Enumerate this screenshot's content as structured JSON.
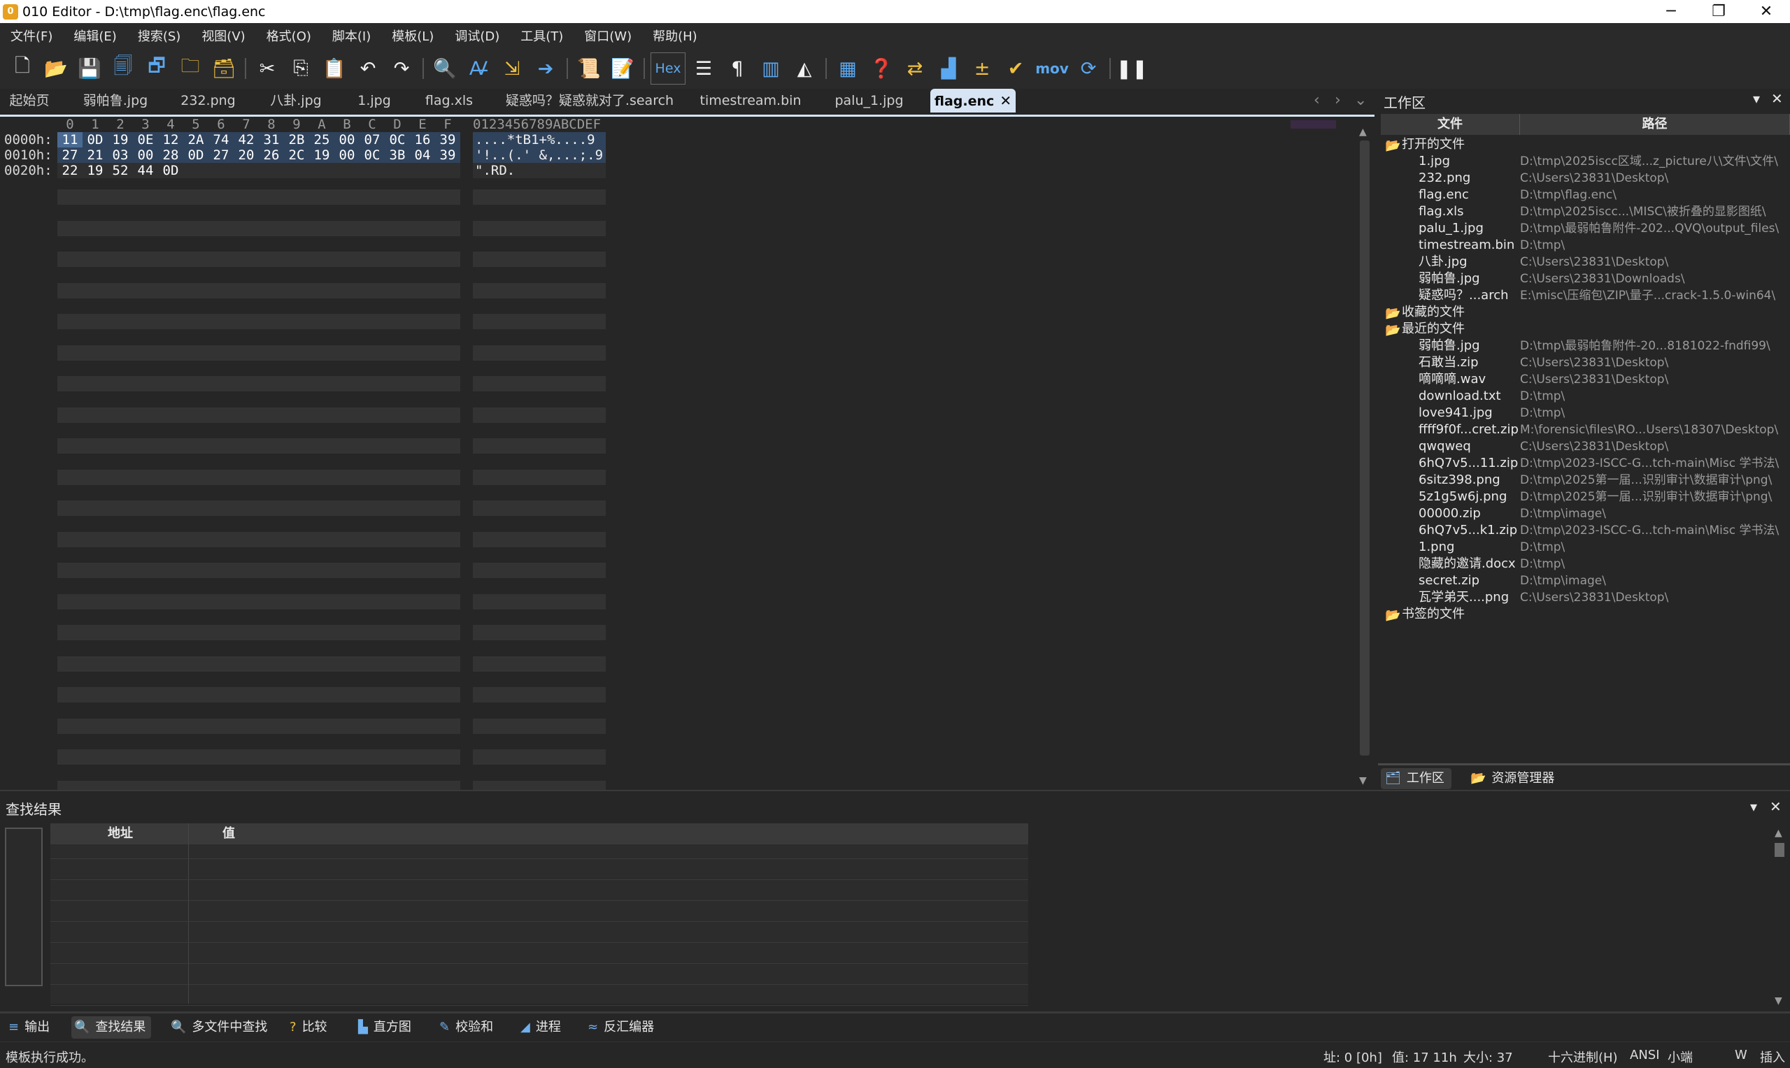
{
  "window": {
    "title": "010 Editor - D:\\tmp\\flag.enc\\flag.enc",
    "controls": [
      "─",
      "❐",
      "✕"
    ]
  },
  "menu": [
    "文件(F)",
    "编辑(E)",
    "搜索(S)",
    "视图(V)",
    "格式(O)",
    "脚本(I)",
    "模板(L)",
    "调试(D)",
    "工具(T)",
    "窗口(W)",
    "帮助(H)"
  ],
  "toolbar": {
    "hex_label": "Hex",
    "mov_label": "mov",
    "icons": [
      "new-file-icon",
      "open-file-icon",
      "save-icon",
      "save-as-icon",
      "save-all-icon",
      "open-folder-icon",
      "workspace-icon",
      "cut-icon",
      "copy-icon",
      "paste-icon",
      "undo-icon",
      "redo-icon",
      "find-icon",
      "replace-icon",
      "goto-icon",
      "jump-icon",
      "run-script-icon",
      "run-template-icon",
      "hex-mode-icon",
      "columns-icon",
      "paragraph-icon",
      "split-view-icon",
      "highlight-icon",
      "calculator-icon",
      "compare-icon",
      "swap-icon",
      "histogram-icon",
      "checksum-icon",
      "verify-icon",
      "mov-icon",
      "base-convert-icon",
      "pause-icon"
    ]
  },
  "tabs": [
    {
      "label": "起始页",
      "active": false
    },
    {
      "label": "弱帕鲁.jpg",
      "active": false
    },
    {
      "label": "232.png",
      "active": false
    },
    {
      "label": "八卦.jpg",
      "active": false
    },
    {
      "label": "1.jpg",
      "active": false
    },
    {
      "label": "flag.xls",
      "active": false
    },
    {
      "label": "疑惑吗？疑惑就对了.search",
      "active": false
    },
    {
      "label": "timestream.bin",
      "active": false
    },
    {
      "label": "palu_1.jpg",
      "active": false
    },
    {
      "label": "flag.enc",
      "active": true
    }
  ],
  "hex": {
    "column_header": [
      "0",
      "1",
      "2",
      "3",
      "4",
      "5",
      "6",
      "7",
      "8",
      "9",
      "A",
      "B",
      "C",
      "D",
      "E",
      "F"
    ],
    "ascii_header": "0123456789ABCDEF",
    "rows": [
      {
        "address": "0000h:",
        "bytes": [
          "11",
          "0D",
          "19",
          "0E",
          "12",
          "2A",
          "74",
          "42",
          "31",
          "2B",
          "25",
          "00",
          "07",
          "0C",
          "16",
          "39"
        ],
        "ascii": "....*tB1+%....9"
      },
      {
        "address": "0010h:",
        "bytes": [
          "27",
          "21",
          "03",
          "00",
          "28",
          "0D",
          "27",
          "20",
          "26",
          "2C",
          "19",
          "00",
          "0C",
          "3B",
          "04",
          "39"
        ],
        "ascii": "'!..(.' &,...;.9"
      },
      {
        "address": "0020h:",
        "bytes": [
          "22",
          "19",
          "52",
          "44",
          "0D"
        ],
        "ascii": "\".RD."
      }
    ]
  },
  "workspace": {
    "title": "工作区",
    "col_file": "文件",
    "col_path": "路径",
    "groups": [
      {
        "label": "打开的文件",
        "files": [
          {
            "name": "1.jpg",
            "path": "D:\\tmp\\2025iscc区域...z_picture八\\文件\\文件\\"
          },
          {
            "name": "232.png",
            "path": "C:\\Users\\23831\\Desktop\\"
          },
          {
            "name": "flag.enc",
            "path": "D:\\tmp\\flag.enc\\"
          },
          {
            "name": "flag.xls",
            "path": "D:\\tmp\\2025iscc...\\MISC\\被折叠的显影图纸\\"
          },
          {
            "name": "palu_1.jpg",
            "path": "D:\\tmp\\最弱帕鲁附件-202...QVQ\\output_files\\"
          },
          {
            "name": "timestream.bin",
            "path": "D:\\tmp\\"
          },
          {
            "name": "八卦.jpg",
            "path": "C:\\Users\\23831\\Desktop\\"
          },
          {
            "name": "弱帕鲁.jpg",
            "path": "C:\\Users\\23831\\Downloads\\"
          },
          {
            "name": "疑惑吗？...arch",
            "path": "E:\\misc\\压缩包\\ZIP\\量子...crack-1.5.0-win64\\"
          }
        ]
      },
      {
        "label": "收藏的文件",
        "files": []
      },
      {
        "label": "最近的文件",
        "files": [
          {
            "name": "弱帕鲁.jpg",
            "path": "D:\\tmp\\最弱帕鲁附件-20...8181022-fndfi99\\"
          },
          {
            "name": "石敢当.zip",
            "path": "C:\\Users\\23831\\Desktop\\"
          },
          {
            "name": "嘀嘀嘀.wav",
            "path": "C:\\Users\\23831\\Desktop\\"
          },
          {
            "name": "download.txt",
            "path": "D:\\tmp\\"
          },
          {
            "name": "love941.jpg",
            "path": "D:\\tmp\\"
          },
          {
            "name": "ffff9f0f...cret.zip",
            "path": "M:\\forensic\\files\\RO...Users\\18307\\Desktop\\"
          },
          {
            "name": "qwqweq",
            "path": "C:\\Users\\23831\\Desktop\\"
          },
          {
            "name": "6hQ7v5...11.zip",
            "path": "D:\\tmp\\2023-ISCC-G...tch-main\\Misc 学书法\\"
          },
          {
            "name": "6sitz398.png",
            "path": "D:\\tmp\\2025第一届...识别审计\\数据审计\\png\\"
          },
          {
            "name": "5z1g5w6j.png",
            "path": "D:\\tmp\\2025第一届...识别审计\\数据审计\\png\\"
          },
          {
            "name": "00000.zip",
            "path": "D:\\tmp\\image\\"
          },
          {
            "name": "6hQ7v5...k1.zip",
            "path": "D:\\tmp\\2023-ISCC-G...tch-main\\Misc 学书法\\"
          },
          {
            "name": "1.png",
            "path": "D:\\tmp\\"
          },
          {
            "name": "隐藏的邀请.docx",
            "path": "D:\\tmp\\"
          },
          {
            "name": "secret.zip",
            "path": "D:\\tmp\\image\\"
          },
          {
            "name": "瓦学弟天....png",
            "path": "C:\\Users\\23831\\Desktop\\"
          }
        ]
      },
      {
        "label": "书签的文件",
        "files": []
      }
    ],
    "bottom_tabs": [
      "工作区",
      "资源管理器"
    ]
  },
  "find": {
    "title": "查找结果",
    "col_address": "地址",
    "col_value": "值"
  },
  "tool_tabs": [
    {
      "label": "输出",
      "icon": "≡",
      "active": false
    },
    {
      "label": "查找结果",
      "icon": "🔍",
      "active": true
    },
    {
      "label": "多文件中查找",
      "icon": "🔍",
      "active": false
    },
    {
      "label": "比较",
      "icon": "?",
      "active": false
    },
    {
      "label": "直方图",
      "icon": "▙",
      "active": false
    },
    {
      "label": "校验和",
      "icon": "✎",
      "active": false
    },
    {
      "label": "进程",
      "icon": "◢",
      "active": false
    },
    {
      "label": "反汇编器",
      "icon": "≈",
      "active": false
    }
  ],
  "status": {
    "message": "模板执行成功。",
    "address": "址: 0 [0h]",
    "value": "值: 17 11h",
    "size": "大小: 37",
    "mode": "十六进制(H)",
    "encoding": "ANSI",
    "endian": "小端",
    "width": "W",
    "insert": "插入"
  },
  "colors": {
    "background": "#262626",
    "selection": "#30435c",
    "active_tab": "#d7e4f4",
    "accent_blue": "#5ba8f0",
    "folder_yellow": "#f0c040"
  }
}
